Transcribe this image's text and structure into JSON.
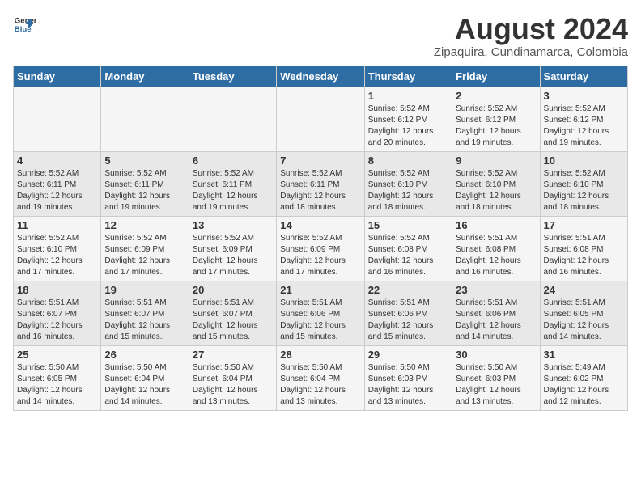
{
  "logo": {
    "line1": "General",
    "line2": "Blue"
  },
  "title": "August 2024",
  "subtitle": "Zipaquira, Cundinamarca, Colombia",
  "weekdays": [
    "Sunday",
    "Monday",
    "Tuesday",
    "Wednesday",
    "Thursday",
    "Friday",
    "Saturday"
  ],
  "weeks": [
    [
      {
        "day": "",
        "info": ""
      },
      {
        "day": "",
        "info": ""
      },
      {
        "day": "",
        "info": ""
      },
      {
        "day": "",
        "info": ""
      },
      {
        "day": "1",
        "info": "Sunrise: 5:52 AM\nSunset: 6:12 PM\nDaylight: 12 hours\nand 20 minutes."
      },
      {
        "day": "2",
        "info": "Sunrise: 5:52 AM\nSunset: 6:12 PM\nDaylight: 12 hours\nand 19 minutes."
      },
      {
        "day": "3",
        "info": "Sunrise: 5:52 AM\nSunset: 6:12 PM\nDaylight: 12 hours\nand 19 minutes."
      }
    ],
    [
      {
        "day": "4",
        "info": "Sunrise: 5:52 AM\nSunset: 6:11 PM\nDaylight: 12 hours\nand 19 minutes."
      },
      {
        "day": "5",
        "info": "Sunrise: 5:52 AM\nSunset: 6:11 PM\nDaylight: 12 hours\nand 19 minutes."
      },
      {
        "day": "6",
        "info": "Sunrise: 5:52 AM\nSunset: 6:11 PM\nDaylight: 12 hours\nand 19 minutes."
      },
      {
        "day": "7",
        "info": "Sunrise: 5:52 AM\nSunset: 6:11 PM\nDaylight: 12 hours\nand 18 minutes."
      },
      {
        "day": "8",
        "info": "Sunrise: 5:52 AM\nSunset: 6:10 PM\nDaylight: 12 hours\nand 18 minutes."
      },
      {
        "day": "9",
        "info": "Sunrise: 5:52 AM\nSunset: 6:10 PM\nDaylight: 12 hours\nand 18 minutes."
      },
      {
        "day": "10",
        "info": "Sunrise: 5:52 AM\nSunset: 6:10 PM\nDaylight: 12 hours\nand 18 minutes."
      }
    ],
    [
      {
        "day": "11",
        "info": "Sunrise: 5:52 AM\nSunset: 6:10 PM\nDaylight: 12 hours\nand 17 minutes."
      },
      {
        "day": "12",
        "info": "Sunrise: 5:52 AM\nSunset: 6:09 PM\nDaylight: 12 hours\nand 17 minutes."
      },
      {
        "day": "13",
        "info": "Sunrise: 5:52 AM\nSunset: 6:09 PM\nDaylight: 12 hours\nand 17 minutes."
      },
      {
        "day": "14",
        "info": "Sunrise: 5:52 AM\nSunset: 6:09 PM\nDaylight: 12 hours\nand 17 minutes."
      },
      {
        "day": "15",
        "info": "Sunrise: 5:52 AM\nSunset: 6:08 PM\nDaylight: 12 hours\nand 16 minutes."
      },
      {
        "day": "16",
        "info": "Sunrise: 5:51 AM\nSunset: 6:08 PM\nDaylight: 12 hours\nand 16 minutes."
      },
      {
        "day": "17",
        "info": "Sunrise: 5:51 AM\nSunset: 6:08 PM\nDaylight: 12 hours\nand 16 minutes."
      }
    ],
    [
      {
        "day": "18",
        "info": "Sunrise: 5:51 AM\nSunset: 6:07 PM\nDaylight: 12 hours\nand 16 minutes."
      },
      {
        "day": "19",
        "info": "Sunrise: 5:51 AM\nSunset: 6:07 PM\nDaylight: 12 hours\nand 15 minutes."
      },
      {
        "day": "20",
        "info": "Sunrise: 5:51 AM\nSunset: 6:07 PM\nDaylight: 12 hours\nand 15 minutes."
      },
      {
        "day": "21",
        "info": "Sunrise: 5:51 AM\nSunset: 6:06 PM\nDaylight: 12 hours\nand 15 minutes."
      },
      {
        "day": "22",
        "info": "Sunrise: 5:51 AM\nSunset: 6:06 PM\nDaylight: 12 hours\nand 15 minutes."
      },
      {
        "day": "23",
        "info": "Sunrise: 5:51 AM\nSunset: 6:06 PM\nDaylight: 12 hours\nand 14 minutes."
      },
      {
        "day": "24",
        "info": "Sunrise: 5:51 AM\nSunset: 6:05 PM\nDaylight: 12 hours\nand 14 minutes."
      }
    ],
    [
      {
        "day": "25",
        "info": "Sunrise: 5:50 AM\nSunset: 6:05 PM\nDaylight: 12 hours\nand 14 minutes."
      },
      {
        "day": "26",
        "info": "Sunrise: 5:50 AM\nSunset: 6:04 PM\nDaylight: 12 hours\nand 14 minutes."
      },
      {
        "day": "27",
        "info": "Sunrise: 5:50 AM\nSunset: 6:04 PM\nDaylight: 12 hours\nand 13 minutes."
      },
      {
        "day": "28",
        "info": "Sunrise: 5:50 AM\nSunset: 6:04 PM\nDaylight: 12 hours\nand 13 minutes."
      },
      {
        "day": "29",
        "info": "Sunrise: 5:50 AM\nSunset: 6:03 PM\nDaylight: 12 hours\nand 13 minutes."
      },
      {
        "day": "30",
        "info": "Sunrise: 5:50 AM\nSunset: 6:03 PM\nDaylight: 12 hours\nand 13 minutes."
      },
      {
        "day": "31",
        "info": "Sunrise: 5:49 AM\nSunset: 6:02 PM\nDaylight: 12 hours\nand 12 minutes."
      }
    ]
  ]
}
